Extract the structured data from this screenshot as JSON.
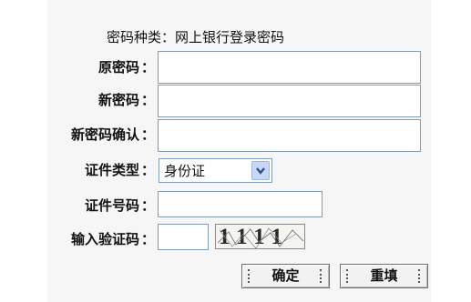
{
  "password_type": {
    "label": "密码种类：",
    "value": "网上银行登录密码"
  },
  "fields": {
    "old_password": {
      "label": "原密码",
      "colon": "：",
      "value": ""
    },
    "new_password": {
      "label": "新密码",
      "colon": "：",
      "value": ""
    },
    "confirm_password": {
      "label": "新密码确认",
      "colon": "：",
      "value": ""
    },
    "id_type": {
      "label": "证件类型",
      "colon": "：",
      "selected": "身份证"
    },
    "id_number": {
      "label": "证件号码",
      "colon": "：",
      "value": ""
    },
    "captcha": {
      "label": "输入验证码",
      "colon": "：",
      "value": "",
      "image_text": "1111"
    }
  },
  "buttons": {
    "confirm": "确定",
    "reset": "重填"
  },
  "icons": {
    "select_arrow": "chevron-down-icon"
  },
  "colors": {
    "panel_bg": "#f6f6f6",
    "input_border": "#7f9db9",
    "select_arrow_bg": "#c8d8f8"
  }
}
